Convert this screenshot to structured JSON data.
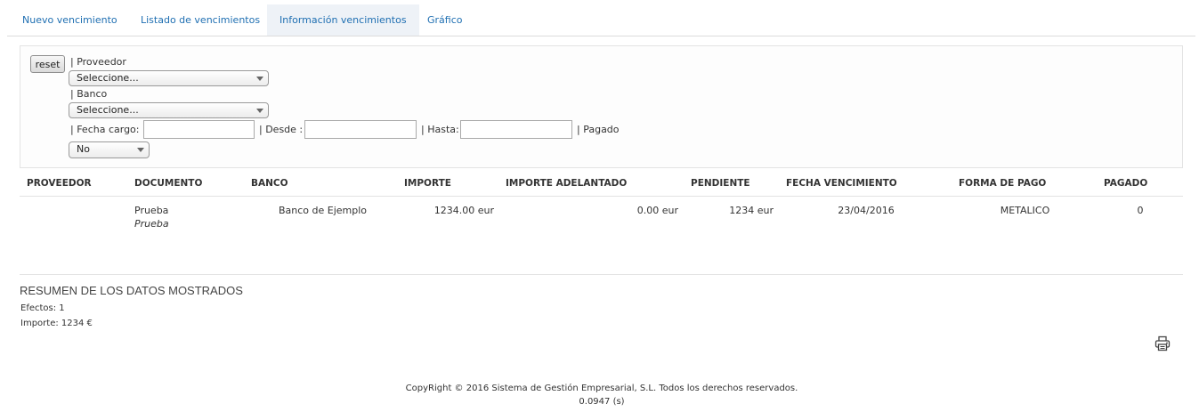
{
  "tabs": [
    {
      "label": "Nuevo vencimiento"
    },
    {
      "label": "Listado de vencimientos"
    },
    {
      "label": "Información vencimientos"
    },
    {
      "label": "Gráfico"
    }
  ],
  "filters": {
    "reset_label": "reset",
    "proveedor_label": "| Proveedor",
    "proveedor_value": "Seleccione...",
    "banco_label": "| Banco",
    "banco_value": "Seleccione...",
    "fecha_cargo_label": "| Fecha cargo:",
    "fecha_cargo_value": "",
    "desde_label": "| Desde :",
    "desde_value": "",
    "hasta_label": "| Hasta:",
    "hasta_value": "",
    "pagado_label": "| Pagado",
    "pagado_value": "No"
  },
  "table": {
    "headers": [
      "PROVEEDOR",
      "DOCUMENTO",
      "BANCO",
      "IMPORTE",
      "IMPORTE ADELANTADO",
      "PENDIENTE",
      "FECHA VENCIMIENTO",
      "FORMA DE PAGO",
      "PAGADO"
    ],
    "rows": [
      {
        "proveedor": "",
        "documento": "Prueba",
        "documento_sub": "Prueba",
        "banco": "Banco de Ejemplo",
        "importe": "1234.00 eur",
        "importe_adelantado": "0.00 eur",
        "pendiente": "1234 eur",
        "fecha_vencimiento": "23/04/2016",
        "forma_pago": "METALICO",
        "pagado": "0"
      }
    ]
  },
  "summary": {
    "title": "RESUMEN DE LOS DATOS MOSTRADOS",
    "efectos": "Efectos: 1",
    "importe": "Importe: 1234 €"
  },
  "icons": {
    "print": "print-icon",
    "select_arrow": "chevron-down-icon"
  },
  "footer": {
    "copyright": "CopyRight © 2016 Sistema de Gestión Empresarial, S.L. Todos los derechos reservados.",
    "timing": "0.0947 (s)"
  }
}
